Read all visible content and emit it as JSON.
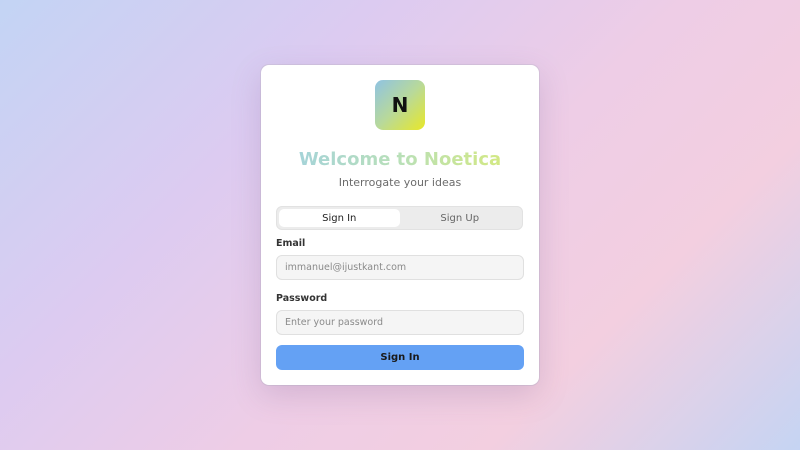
{
  "logo": {
    "letter": "N"
  },
  "header": {
    "title": "Welcome to Noetica",
    "subtitle": "Interrogate your ideas"
  },
  "tabs": [
    {
      "label": "Sign In",
      "active": true
    },
    {
      "label": "Sign Up",
      "active": false
    }
  ],
  "form": {
    "email_label": "Email",
    "email_placeholder": "immanuel@ijustkant.com",
    "password_label": "Password",
    "password_placeholder": "Enter your password",
    "submit_label": "Sign In"
  },
  "colors": {
    "primary_button": "#64a1f4",
    "logo_gradient_start": "#8fc3e3",
    "logo_gradient_end": "#e8e828"
  }
}
